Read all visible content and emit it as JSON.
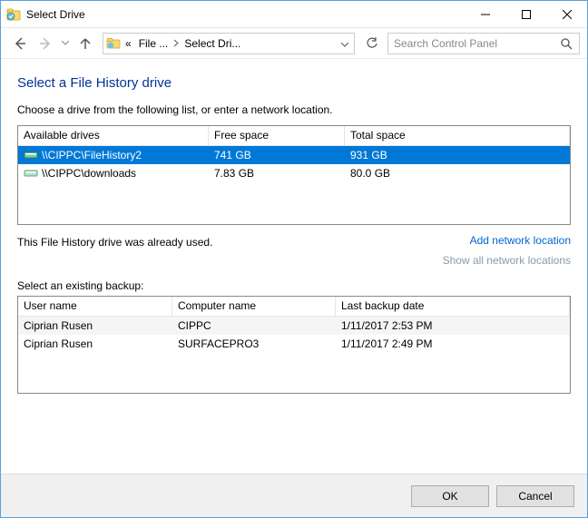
{
  "window": {
    "title": "Select Drive"
  },
  "breadcrumb": {
    "part1": "File ...",
    "part2": "Select Dri..."
  },
  "search": {
    "placeholder": "Search Control Panel"
  },
  "page": {
    "title": "Select a File History drive",
    "instruction": "Choose a drive from the following list, or enter a network location."
  },
  "drives_table": {
    "columns": [
      "Available drives",
      "Free space",
      "Total space"
    ],
    "rows": [
      {
        "name": "\\\\CIPPC\\FileHistory2",
        "free": "741 GB",
        "total": "931 GB",
        "selected": true
      },
      {
        "name": "\\\\CIPPC\\downloads",
        "free": "7.83 GB",
        "total": "80.0 GB",
        "selected": false
      }
    ]
  },
  "status": {
    "message": "This File History drive was already used.",
    "add_link": "Add network location",
    "show_link": "Show all network locations"
  },
  "backups_label": "Select an existing backup:",
  "backups_table": {
    "columns": [
      "User name",
      "Computer name",
      "Last backup date"
    ],
    "rows": [
      {
        "user": "Ciprian Rusen",
        "computer": "CIPPC",
        "date": "1/11/2017 2:53 PM"
      },
      {
        "user": "Ciprian Rusen",
        "computer": "SURFACEPRO3",
        "date": "1/11/2017 2:49 PM"
      }
    ]
  },
  "buttons": {
    "ok": "OK",
    "cancel": "Cancel"
  }
}
